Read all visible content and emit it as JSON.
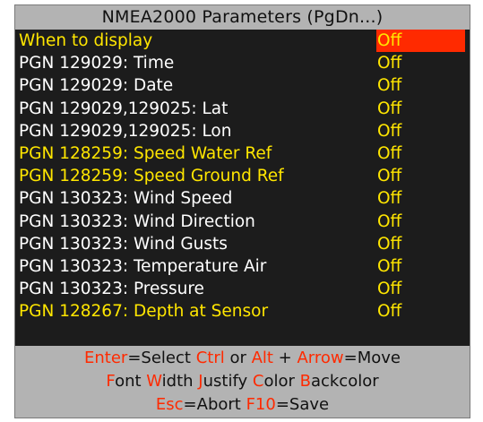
{
  "title": "NMEA2000 Parameters (PgDn...)",
  "colors": {
    "yellow": "#ffe600",
    "white": "#ffffff",
    "red": "#ff2a00",
    "list_bg": "#1c1c1c",
    "bar_bg": "#b3b3b3"
  },
  "rows": [
    {
      "label": "When to display",
      "value": "Off",
      "label_color": "yellow",
      "selected": true
    },
    {
      "label": "PGN 129029: Time",
      "value": "Off",
      "label_color": "white",
      "selected": false
    },
    {
      "label": "PGN 129029: Date",
      "value": "Off",
      "label_color": "white",
      "selected": false
    },
    {
      "label": "PGN 129029,129025: Lat",
      "value": "Off",
      "label_color": "white",
      "selected": false
    },
    {
      "label": "PGN 129029,129025: Lon",
      "value": "Off",
      "label_color": "white",
      "selected": false
    },
    {
      "label": "PGN 128259: Speed Water Ref",
      "value": "Off",
      "label_color": "yellow",
      "selected": false
    },
    {
      "label": "PGN 128259: Speed Ground Ref",
      "value": "Off",
      "label_color": "yellow",
      "selected": false
    },
    {
      "label": "PGN 130323: Wind Speed",
      "value": "Off",
      "label_color": "white",
      "selected": false
    },
    {
      "label": "PGN 130323: Wind Direction",
      "value": "Off",
      "label_color": "white",
      "selected": false
    },
    {
      "label": "PGN 130323: Wind Gusts",
      "value": "Off",
      "label_color": "white",
      "selected": false
    },
    {
      "label": "PGN 130323: Temperature Air",
      "value": "Off",
      "label_color": "white",
      "selected": false
    },
    {
      "label": "PGN 130323: Pressure",
      "value": "Off",
      "label_color": "white",
      "selected": false
    },
    {
      "label": "PGN 128267: Depth at Sensor",
      "value": "Off",
      "label_color": "yellow",
      "selected": false
    },
    {
      "label": "",
      "value": "",
      "label_color": "white",
      "selected": false
    }
  ],
  "footer": {
    "line1": [
      {
        "text": "Enter",
        "hot": true
      },
      {
        "text": "=Select ",
        "hot": false
      },
      {
        "text": "Ctrl",
        "hot": true
      },
      {
        "text": " or ",
        "hot": false
      },
      {
        "text": "Alt",
        "hot": true
      },
      {
        "text": " + ",
        "hot": false
      },
      {
        "text": "Arrow",
        "hot": true
      },
      {
        "text": "=Move",
        "hot": false
      }
    ],
    "line2": [
      {
        "text": "F",
        "hot": true
      },
      {
        "text": "ont ",
        "hot": false
      },
      {
        "text": "W",
        "hot": true
      },
      {
        "text": "idth ",
        "hot": false
      },
      {
        "text": "J",
        "hot": true
      },
      {
        "text": "ustify ",
        "hot": false
      },
      {
        "text": "C",
        "hot": true
      },
      {
        "text": "olor ",
        "hot": false
      },
      {
        "text": "B",
        "hot": true
      },
      {
        "text": "ackcolor",
        "hot": false
      }
    ],
    "line3": [
      {
        "text": "Esc",
        "hot": true
      },
      {
        "text": "=Abort ",
        "hot": false
      },
      {
        "text": "F10",
        "hot": true
      },
      {
        "text": "=Save",
        "hot": false
      }
    ]
  }
}
